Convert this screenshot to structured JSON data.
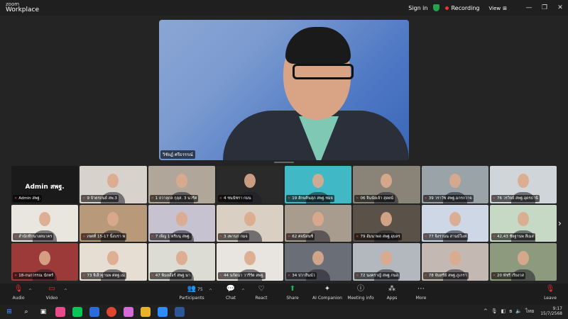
{
  "app": {
    "logo_top": "zoom",
    "logo_bottom": "Workplace"
  },
  "titlebar": {
    "sign_in": "Sign in",
    "recording": "Recording",
    "view": "View",
    "view_icon": "grid-icon"
  },
  "speaker": {
    "name": "วิชัยฏ์ ศรีธรรรณ์"
  },
  "participants": [
    {
      "label": "Admin สพฐ.",
      "bigname": "Admin สพฐ.",
      "bg": "#1a1a1a"
    },
    {
      "label": "9 จ้าตรถนย์ สพ.3",
      "bg": "#d8d2cc"
    },
    {
      "label": "1 ถวาลุกล กุลุส. 3 นวรีศ",
      "bg": "#b0a79a"
    },
    {
      "label": "4 ชนนัชรา กมน",
      "bg": "#2a2a2a"
    },
    {
      "label": "19 สักษคินสุภ สพฐ.ชมจ",
      "bg": "#40b8c6"
    },
    {
      "label": "06 จินนัยเจ้า สุดยนั่",
      "bg": "#8a8478"
    },
    {
      "label": "39 วราวัช สพฐ.มกรกวาจ",
      "bg": "#9aa3a8"
    },
    {
      "label": "76 วรวิจย์ สพฐ.อุดรธานี",
      "bg": "#cfd5d8"
    },
    {
      "label": "สำนักทึกนางตนาคร",
      "bg": "#e9e6df"
    },
    {
      "label": "เขตที่ 15-17 นิ้งบรา พ",
      "bg": "#b89a7a"
    },
    {
      "label": "7 เพ็ญ 1 ตรีบนุ สพฐ.",
      "bg": "#c7c2d0"
    },
    {
      "label": "3 งพานก กมจ",
      "bg": "#d9cfc3"
    },
    {
      "label": "62 ศจนีสนซิ่",
      "bg": "#a89c8e"
    },
    {
      "label": "79 อัมนาพล สพฐ.อุบลร",
      "bg": "#5a5148"
    },
    {
      "label": "77 จิงรานน สานบ์ใแท",
      "bg": "#cdd7e6"
    },
    {
      "label": "42,43 ชัยฐานพ สีเมส",
      "bg": "#c6d9c4"
    },
    {
      "label": "18-กนกวรรณ นักทร์",
      "bg": "#9c3a3a"
    },
    {
      "label": "73 จีเล็วฐานพ ศตฐ.เน",
      "bg": "#e6ded2"
    },
    {
      "label": "47 พิมลอ๊อร์ สพฐ.นา",
      "bg": "#dcdcd4"
    },
    {
      "label": "44 นกัดนา วารีรัต สพฐ.",
      "bg": "#e8e4e0"
    },
    {
      "label": "34 ปวาลีนน์ว่",
      "bg": "#6a6e76"
    },
    {
      "label": "72 นงคราญ์ สพฐ.กนอ",
      "bg": "#b2b8bd"
    },
    {
      "label": "78 จันทรีย์ สพฐ.ภูเกรา",
      "bg": "#c4b8b2"
    },
    {
      "label": "20 พัชรี เรียงวส",
      "bg": "#8e9a7e"
    }
  ],
  "toolbar": {
    "audio": "Audio",
    "video": "Video",
    "participants": "Participants",
    "participants_count": "75",
    "chat": "Chat",
    "react": "React",
    "share": "Share",
    "ai": "AI Companion",
    "meeting_info": "Meeting info",
    "apps": "Apps",
    "more": "More",
    "leave": "Leave",
    "icons": {
      "audio": "mic-muted-icon",
      "video": "video-off-icon",
      "participants": "people-icon",
      "chat": "chat-icon",
      "react": "heart-icon",
      "share": "share-arrow-icon",
      "ai": "sparkle-icon",
      "meeting_info": "info-icon",
      "apps": "apps-icon",
      "more": "more-icon",
      "leave": "leave-icon"
    }
  },
  "taskbar": {
    "time": "9:17",
    "date": "15/7/2568",
    "lang": "ไทย"
  }
}
